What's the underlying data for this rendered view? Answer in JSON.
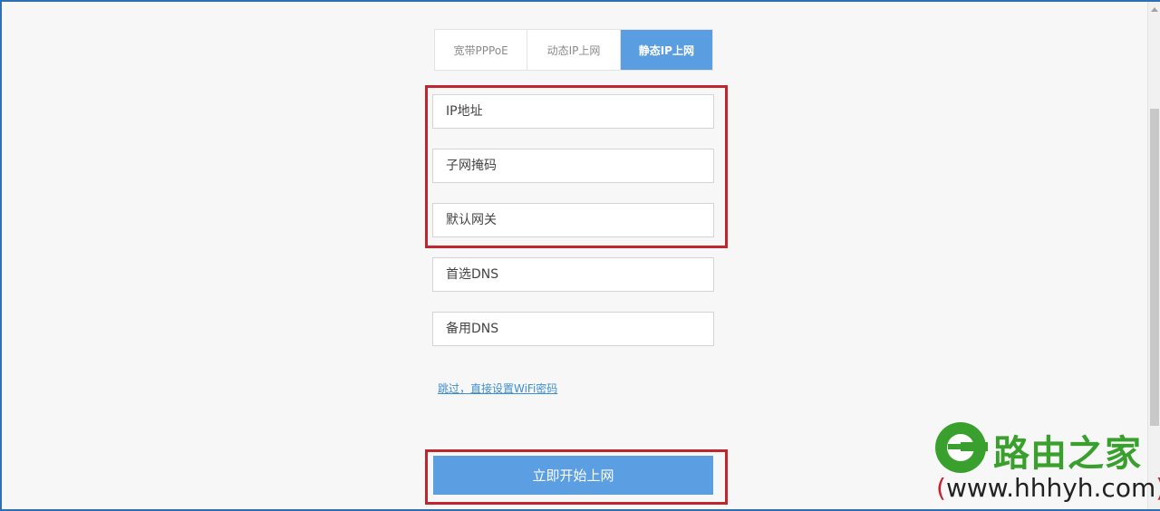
{
  "tabs": [
    {
      "label": "宽带PPPoE",
      "active": false
    },
    {
      "label": "动态IP上网",
      "active": false
    },
    {
      "label": "静态IP上网",
      "active": true
    }
  ],
  "fields": {
    "ip_address": {
      "placeholder": "IP地址",
      "value": ""
    },
    "subnet_mask": {
      "placeholder": "子网掩码",
      "value": ""
    },
    "default_gateway": {
      "placeholder": "默认网关",
      "value": ""
    },
    "primary_dns": {
      "placeholder": "首选DNS",
      "value": ""
    },
    "secondary_dns": {
      "placeholder": "备用DNS",
      "value": ""
    }
  },
  "skip_link": "跳过，直接设置WiFi密码",
  "start_button": "立即开始上网",
  "watermark": {
    "title": "路由之家",
    "url_open": "(",
    "url": "www.hhhyh.com",
    "url_close": ")"
  },
  "colors": {
    "accent": "#5a9de0",
    "highlight_box": "#c0262d",
    "watermark_green": "#3aa02d"
  }
}
